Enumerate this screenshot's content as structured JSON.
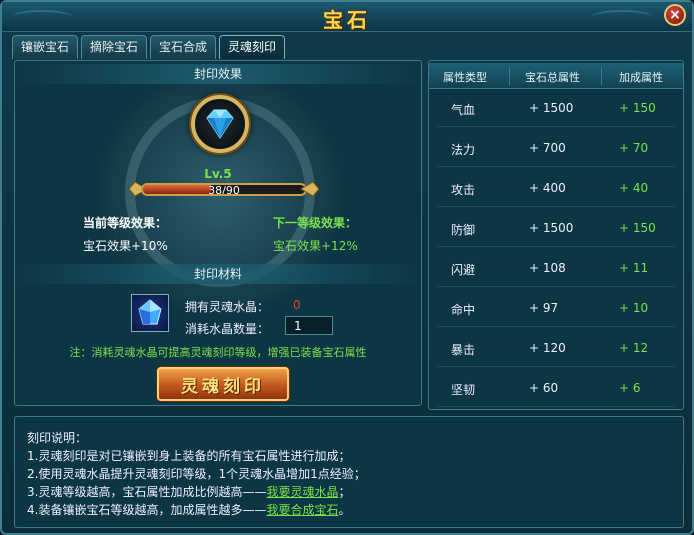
{
  "window": {
    "title": "宝石",
    "close_label": "×"
  },
  "tabs": [
    {
      "label": "镶嵌宝石",
      "active": false
    },
    {
      "label": "摘除宝石",
      "active": false
    },
    {
      "label": "宝石合成",
      "active": false
    },
    {
      "label": "灵魂刻印",
      "active": true
    }
  ],
  "seal": {
    "section_title": "封印效果",
    "level": "Lv.5",
    "exp_text": "38/90",
    "exp_fraction": 0.4222,
    "current_label": "当前等级效果：",
    "current_value": "宝石效果+10%",
    "next_label": "下一等级效果：",
    "next_value": "宝石效果+12%"
  },
  "materials": {
    "section_title": "封印材料",
    "owned_label": "拥有灵魂水晶：",
    "owned_value": "0",
    "cost_label": "消耗水晶数量：",
    "cost_value": "1",
    "note": "注：消耗灵魂水晶可提高灵魂刻印等级，增强已装备宝石属性",
    "button_label": "灵魂刻印"
  },
  "attributes": {
    "headers": [
      "属性类型",
      "宝石总属性",
      "加成属性"
    ],
    "rows": [
      {
        "name": "气血",
        "total": "+ 1500",
        "bonus": "+ 150"
      },
      {
        "name": "法力",
        "total": "+ 700",
        "bonus": "+ 70"
      },
      {
        "name": "攻击",
        "total": "+ 400",
        "bonus": "+ 40"
      },
      {
        "name": "防御",
        "total": "+ 1500",
        "bonus": "+ 150"
      },
      {
        "name": "闪避",
        "total": "+ 108",
        "bonus": "+ 11"
      },
      {
        "name": "命中",
        "total": "+ 97",
        "bonus": "+ 10"
      },
      {
        "name": "暴击",
        "total": "+ 120",
        "bonus": "+ 12"
      },
      {
        "name": "坚韧",
        "total": "+ 60",
        "bonus": "+ 6"
      }
    ]
  },
  "description": {
    "title": "刻印说明：",
    "line1": "1.灵魂刻印是对已镶嵌到身上装备的所有宝石属性进行加成；",
    "line2": "2.使用灵魂水晶提升灵魂刻印等级，1个灵魂水晶增加1点经验；",
    "line3_text": "3.灵魂等级越高，宝石属性加成比例越高——",
    "line3_link": "我要灵魂水晶",
    "line3_end": "；",
    "line4_text": "4.装备镶嵌宝石等级越高，加成属性越多——",
    "line4_link": "我要合成宝石",
    "line4_end": "。"
  },
  "colors": {
    "accent_green": "#7be24a",
    "title_gold": "#ffd84a",
    "warn_red": "#e03b2b"
  },
  "icons": {
    "close": "close-icon",
    "gem": "diamond-gem-icon",
    "crystal": "soul-crystal-icon"
  }
}
